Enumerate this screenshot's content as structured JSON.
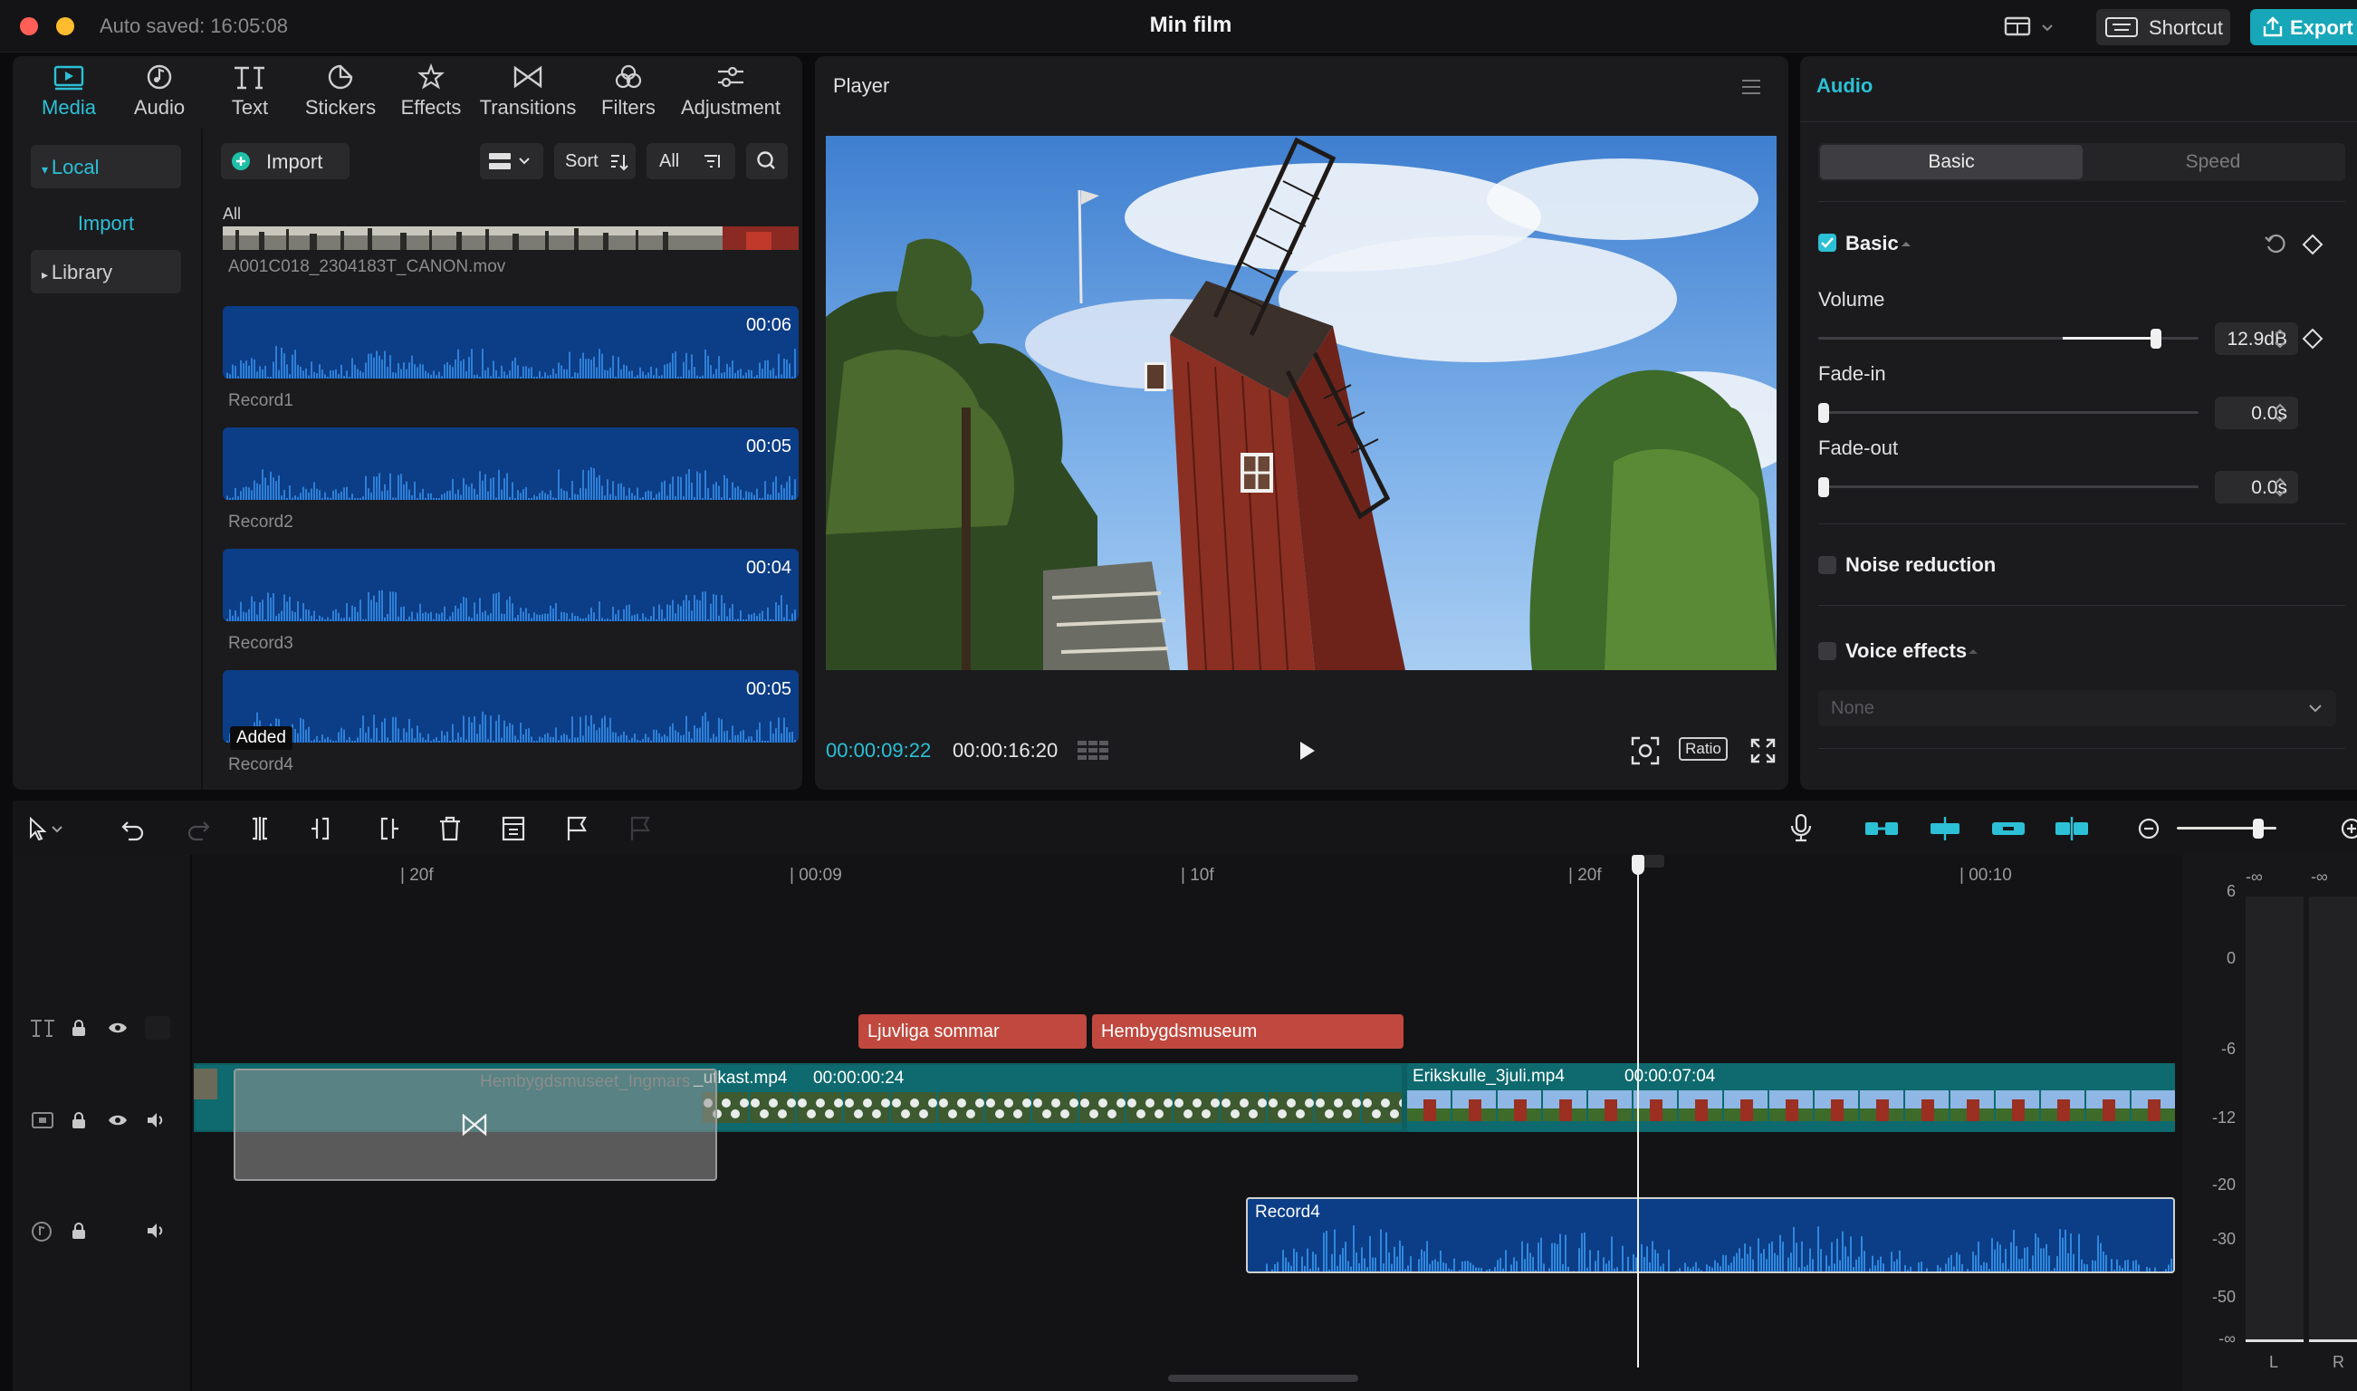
{
  "titlebar": {
    "autosave": "Auto saved: 16:05:08",
    "title": "Min film",
    "shortcut_label": "Shortcut",
    "export_label": "Export",
    "close_color": "#ff5f57",
    "minimize_color": "#febc2e"
  },
  "media_tabs": [
    {
      "label": "Media",
      "icon": "media-icon"
    },
    {
      "label": "Audio",
      "icon": "audio-icon"
    },
    {
      "label": "Text",
      "icon": "text-icon"
    },
    {
      "label": "Stickers",
      "icon": "stickers-icon"
    },
    {
      "label": "Effects",
      "icon": "effects-icon"
    },
    {
      "label": "Transitions",
      "icon": "transitions-icon"
    },
    {
      "label": "Filters",
      "icon": "filters-icon"
    },
    {
      "label": "Adjustment",
      "icon": "adjustment-icon"
    }
  ],
  "nav": {
    "local": "Local",
    "import": "Import",
    "library": "Library"
  },
  "media_toolbar": {
    "import_label": "Import",
    "sort_label": "Sort",
    "all_label": "All"
  },
  "media": {
    "section": "All",
    "video_name": "A001C018_2304183T_CANON.mov",
    "audio_items": [
      {
        "name": "Record1",
        "duration": "00:06"
      },
      {
        "name": "Record2",
        "duration": "00:05"
      },
      {
        "name": "Record3",
        "duration": "00:04"
      },
      {
        "name": "Record4",
        "duration": "00:05",
        "badge": "Added"
      }
    ]
  },
  "player": {
    "label": "Player",
    "current_time": "00:00:09:22",
    "total_time": "00:00:16:20",
    "ratio_label": "Ratio"
  },
  "audio_panel": {
    "title": "Audio",
    "tab_basic": "Basic",
    "tab_speed": "Speed",
    "section_basic": "Basic",
    "volume_label": "Volume",
    "volume_value": "12.9dB",
    "volume_level": 0.9,
    "fadein_label": "Fade-in",
    "fadein_value": "0.0s",
    "fadeout_label": "Fade-out",
    "fadeout_value": "0.0s",
    "noise_label": "Noise reduction",
    "voice_label": "Voice effects",
    "voice_select": "None",
    "accent": "#2cc0d6"
  },
  "timeline": {
    "ruler_ticks": [
      "20f",
      "00:09",
      "10f",
      "20f",
      "00:10"
    ],
    "text_clips": [
      "Ljuvliga sommar",
      "Hembygdsmuseum"
    ],
    "video_clip1_name": "Hembygdsmuseet_Ingmars",
    "video_clip1_suffix": "_utkast.mp4",
    "video_clip1_dur": "00:00:00:24",
    "video_clip2_name": "Erikskulle_3juli.mp4",
    "video_clip2_dur": "00:00:07:04",
    "audio_clip": "Record4",
    "text_clip_color": "#c0483e",
    "video_track_color": "#0d5f63",
    "audio_clip_color": "#0c3d87"
  },
  "meter": {
    "peak_l": "-∞",
    "peak_r": "-∞",
    "scale": [
      "6",
      "0",
      "-6",
      "-12",
      "-20",
      "-30",
      "-50",
      "-∞"
    ],
    "left": "L",
    "right": "R"
  }
}
